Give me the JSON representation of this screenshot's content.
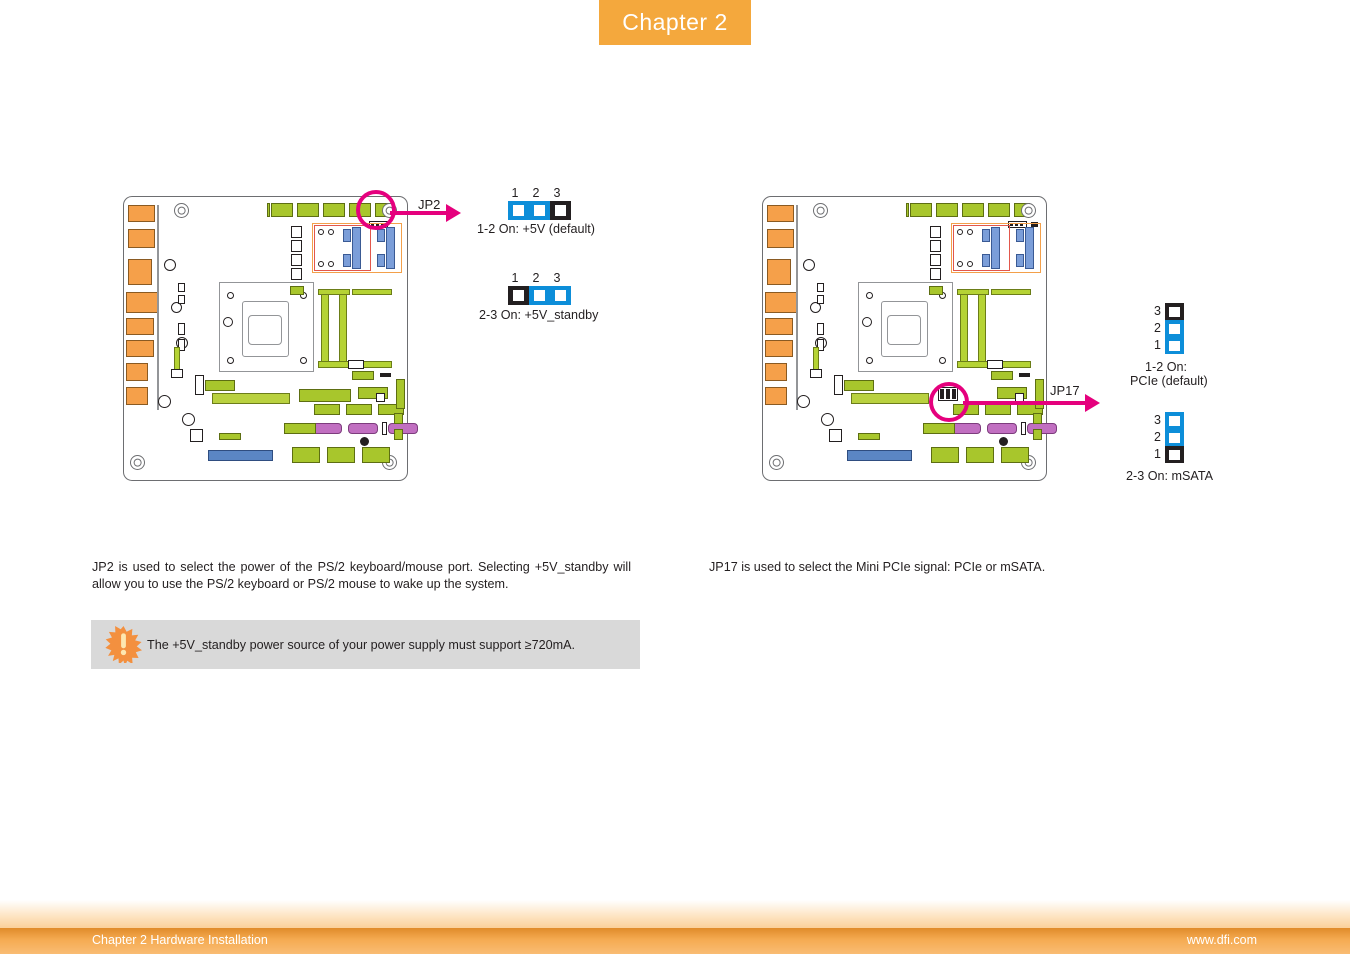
{
  "header": {
    "chapter_label": "Chapter 2"
  },
  "footer": {
    "left": "Chapter 2 Hardware Installation",
    "right": "www.dfi.com"
  },
  "colors": {
    "accent_orange": "#f4a83d",
    "callout_magenta": "#e5007d",
    "jumper_blue": "#0d8ed9",
    "jumper_black": "#231f20",
    "note_bg": "#d9d9d9"
  },
  "left_section": {
    "callout_label": "JP2",
    "paragraph": "JP2 is used to select the power of the PS/2 keyboard/mouse port. Selecting +5V_standby will allow you to use the PS/2 keyboard or PS/2 mouse to wake up the system.",
    "jumpers": [
      {
        "pin_labels": [
          "1",
          "2",
          "3"
        ],
        "states": [
          "blue",
          "blue",
          "black"
        ],
        "caption": "1-2 On: +5V (default)"
      },
      {
        "pin_labels": [
          "1",
          "2",
          "3"
        ],
        "states": [
          "black",
          "blue",
          "blue"
        ],
        "caption": "2-3 On: +5V_standby"
      }
    ],
    "note": {
      "icon": "warning-starburst-icon",
      "text": "The +5V_standby power source of your power supply must support ≥720mA."
    }
  },
  "right_section": {
    "callout_label": "JP17",
    "paragraph": "JP17 is used to select the Mini PCIe signal: PCIe or mSATA.",
    "jumpers": [
      {
        "pin_labels": [
          "3",
          "2",
          "1"
        ],
        "states": [
          "black",
          "blue",
          "blue"
        ],
        "caption_line1": "1-2 On:",
        "caption_line2": "PCIe (default)"
      },
      {
        "pin_labels": [
          "3",
          "2",
          "1"
        ],
        "states": [
          "blue",
          "blue",
          "black"
        ],
        "caption": "2-3 On: mSATA"
      }
    ]
  }
}
